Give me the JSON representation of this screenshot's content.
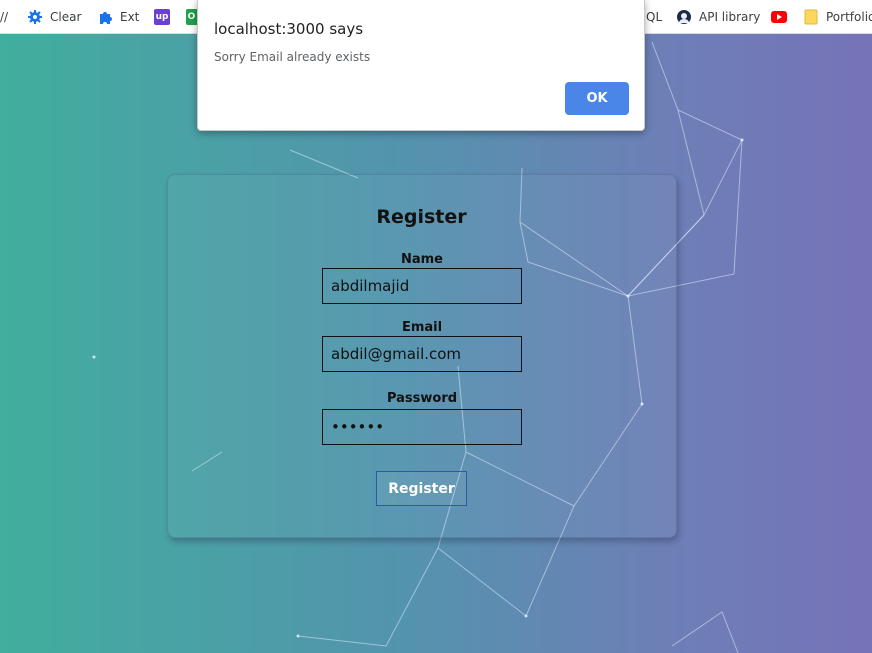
{
  "bookmarks_bar": {
    "items": [
      {
        "label": "//",
        "icon": "none"
      },
      {
        "label": "Clear",
        "icon": "gear-icon"
      },
      {
        "label": "Ext",
        "icon": "puzzle-icon"
      },
      {
        "label": "",
        "icon": "upwork-icon",
        "badge_text": "up"
      },
      {
        "label": "",
        "icon": "green-app-icon",
        "badge_text": "O"
      },
      {
        "label": "QL",
        "icon": "none"
      },
      {
        "label": "API library",
        "icon": "user-avatar-icon"
      },
      {
        "label": "",
        "icon": "youtube-icon"
      },
      {
        "label": "Portfolio",
        "icon": "folder-icon"
      }
    ]
  },
  "register_form": {
    "title": "Register",
    "name": {
      "label": "Name",
      "value": "abdilmajid"
    },
    "email": {
      "label": "Email",
      "value": "abdil@gmail.com"
    },
    "password": {
      "label": "Password",
      "value": "••••••"
    },
    "submit_label": "Register"
  },
  "alert_dialog": {
    "title": "localhost:3000 says",
    "message": "Sorry Email already exists",
    "ok_label": "OK"
  },
  "colors": {
    "gradient_start": "#41ae9e",
    "gradient_end": "#7673b8",
    "ok_button": "#4a86e8"
  }
}
